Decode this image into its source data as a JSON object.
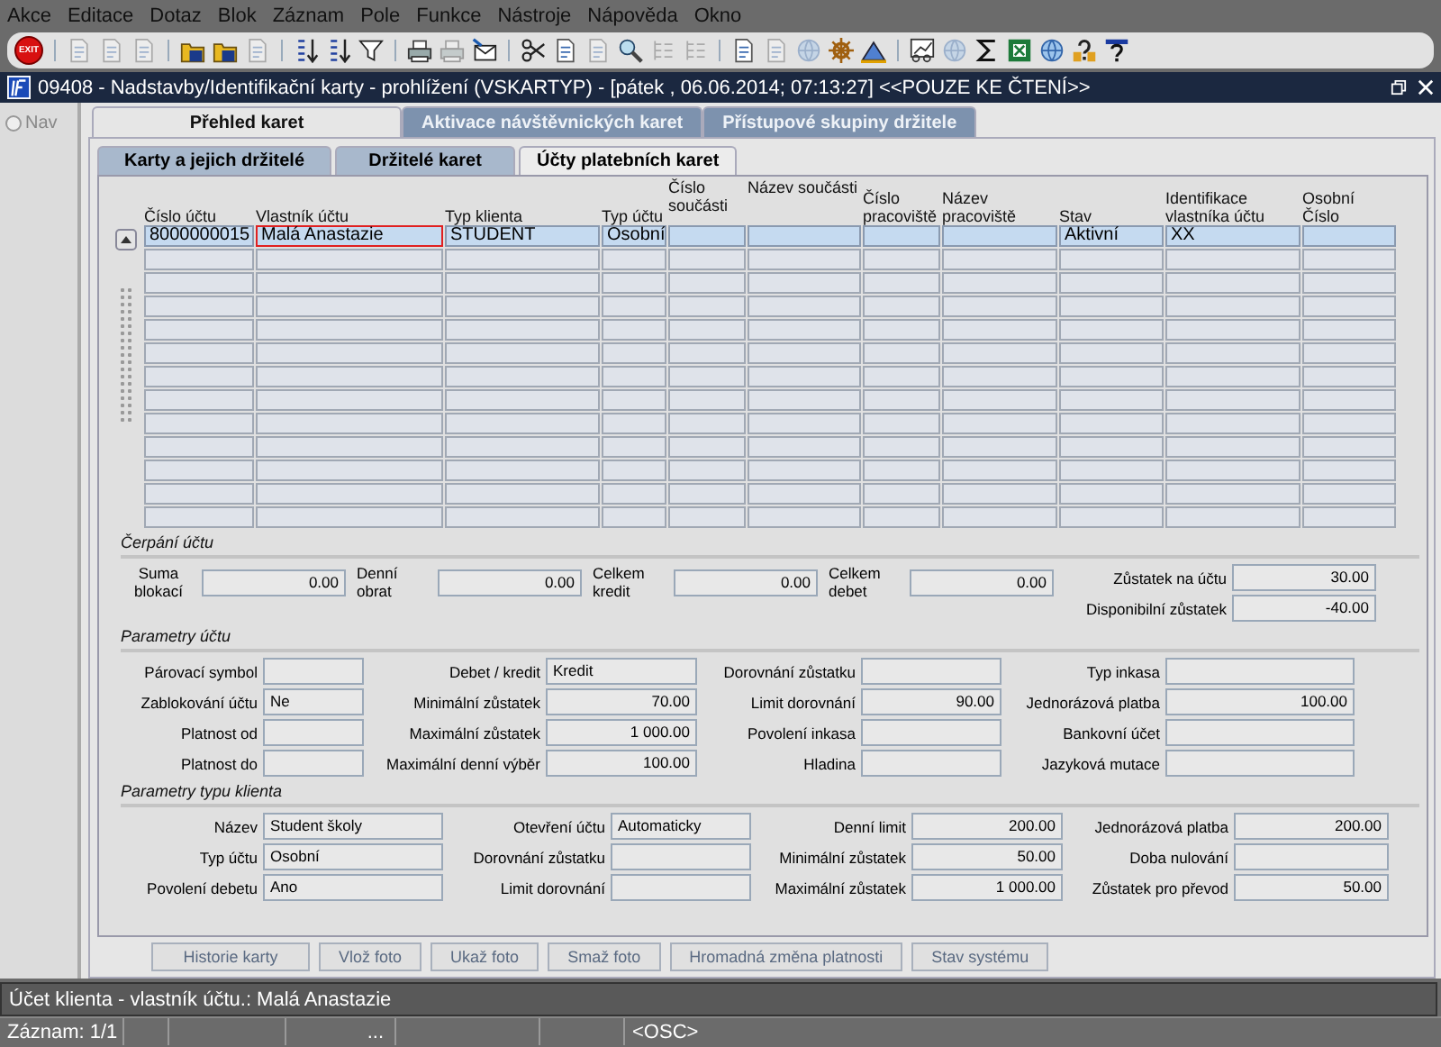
{
  "menu": [
    "Akce",
    "Editace",
    "Dotaz",
    "Blok",
    "Záznam",
    "Pole",
    "Funkce",
    "Nástroje",
    "Nápověda",
    "Okno"
  ],
  "toolbar": {
    "exit_label": "EXIT"
  },
  "window": {
    "title": "09408 - Nadstavby/Identifikační karty - prohlížení (VSKARTYP) - [pátek  , 06.06.2014; 07:13:27] <<POUZE KE ČTENÍ>>"
  },
  "nav": {
    "label": "Nav",
    "selected": false
  },
  "tabs": [
    {
      "label": "Přehled karet",
      "selected": true,
      "disabled": false
    },
    {
      "label": "Aktivace návštěvnických karet",
      "selected": false,
      "disabled": true
    },
    {
      "label": "Přístupové skupiny držitele",
      "selected": false,
      "disabled": true
    }
  ],
  "subtabs": [
    {
      "label": "Karty a jejich držitelé",
      "selected": false
    },
    {
      "label": "Držitelé karet",
      "selected": false
    },
    {
      "label": "Účty platebních karet",
      "selected": true
    }
  ],
  "grid": {
    "columns": [
      "Číslo účtu",
      "Vlastník účtu",
      "Typ klienta",
      "Typ účtu",
      "Číslo součásti",
      "Název součásti",
      "Číslo pracoviště",
      "Název pracoviště",
      "Stav",
      "Identifikace vlastníka účtu",
      "Osobní Číslo"
    ],
    "rows": [
      {
        "cells": [
          {
            "text": "8000000015",
            "focused": false
          },
          {
            "text": "Malá Anastazie",
            "focused": true
          },
          {
            "text": "STUDENT",
            "focused": false
          },
          {
            "text": "Osobní",
            "focused": false
          },
          {
            "focused": false
          },
          {
            "focused": false
          },
          {
            "focused": false
          },
          {
            "focused": false
          },
          {
            "text": "Aktivní",
            "focused": false
          },
          {
            "text": "XX",
            "focused": false
          },
          {
            "focused": false
          }
        ]
      }
    ]
  },
  "sections": [
    {
      "title": "Čerpání účtu",
      "columns": [
        [
          {
            "label": "Suma blokací",
            "value": "0.00",
            "kind": "amount"
          }
        ],
        [
          {
            "label": "Denní obrat",
            "value": "0.00",
            "kind": "amount"
          }
        ],
        [
          {
            "label": "Celkem kredit",
            "value": "0.00",
            "kind": "amount"
          }
        ],
        [
          {
            "label": "Celkem debet",
            "value": "0.00",
            "kind": "amount"
          }
        ],
        [
          {
            "label": "Zůstatek na účtu",
            "value": "30.00",
            "kind": "amount"
          },
          {
            "label": "Disponibilní zůstatek",
            "value": "-40.00",
            "kind": "amount"
          }
        ]
      ]
    },
    {
      "title": "Parametry účtu",
      "columns": [
        [
          {
            "label": "Párovací symbol",
            "kind": "text"
          },
          {
            "label": "Zablokování účtu",
            "value": "Ne",
            "kind": "text"
          },
          {
            "label": "Platnost od",
            "kind": "text"
          },
          {
            "label": "Platnost do",
            "kind": "text"
          }
        ],
        [
          {
            "label": "Debet / kredit",
            "value": "Kredit",
            "kind": "text"
          },
          {
            "label": "Minimální zůstatek",
            "value": "70.00",
            "kind": "amount"
          },
          {
            "label": "Maximální zůstatek",
            "value": "1 000.00",
            "kind": "amount"
          },
          {
            "label": "Maximální denní výběr",
            "value": "100.00",
            "kind": "amount"
          }
        ],
        [
          {
            "label": "Dorovnání zůstatku",
            "kind": "text"
          },
          {
            "label": "Limit dorovnání",
            "value": "90.00",
            "kind": "amount"
          },
          {
            "label": "Povolení inkasa",
            "kind": "text"
          },
          {
            "label": "Hladina",
            "kind": "text"
          }
        ],
        [
          {
            "label": "Typ inkasa",
            "kind": "text"
          },
          {
            "label": "Jednorázová platba",
            "value": "100.00",
            "kind": "amount"
          },
          {
            "label": "Bankovní účet",
            "kind": "text"
          },
          {
            "label": "Jazyková mutace",
            "kind": "text"
          }
        ]
      ]
    },
    {
      "title": "Parametry typu klienta",
      "columns": [
        [
          {
            "label": "Název",
            "value": "Student školy",
            "kind": "text"
          },
          {
            "label": "Typ účtu",
            "value": "Osobní",
            "kind": "text"
          },
          {
            "label": "Povolení debetu",
            "value": "Ano",
            "kind": "text"
          }
        ],
        [
          {
            "label": "Otevření účtu",
            "value": "Automaticky",
            "kind": "text"
          },
          {
            "label": "Dorovnání zůstatku",
            "kind": "text"
          },
          {
            "label": "Limit dorovnání",
            "kind": "text"
          }
        ],
        [
          {
            "label": "Denní limit",
            "value": "200.00",
            "kind": "amount"
          },
          {
            "label": "Minimální zůstatek",
            "value": "50.00",
            "kind": "amount"
          },
          {
            "label": "Maximální zůstatek",
            "value": "1 000.00",
            "kind": "amount"
          }
        ],
        [
          {
            "label": "Jednorázová platba",
            "value": "200.00",
            "kind": "amount"
          },
          {
            "label": "Doba nulování",
            "kind": "text"
          },
          {
            "label": "Zůstatek pro převod",
            "value": "50.00",
            "kind": "amount"
          }
        ]
      ]
    }
  ],
  "buttons": [
    {
      "label": "Historie karty",
      "disabled": true
    },
    {
      "label": "Vlož foto",
      "disabled": true
    },
    {
      "label": "Ukaž foto",
      "disabled": true
    },
    {
      "label": "Smaž foto",
      "disabled": true
    },
    {
      "label": "Hromadná změna platnosti",
      "disabled": true
    },
    {
      "label": "Stav systému",
      "disabled": true
    }
  ],
  "status": {
    "message": "Účet klienta - vlastník účtu.: Malá Anastazie",
    "record": "Záznam: 1/1",
    "ellipsis": "...",
    "mode": "<OSC>"
  }
}
